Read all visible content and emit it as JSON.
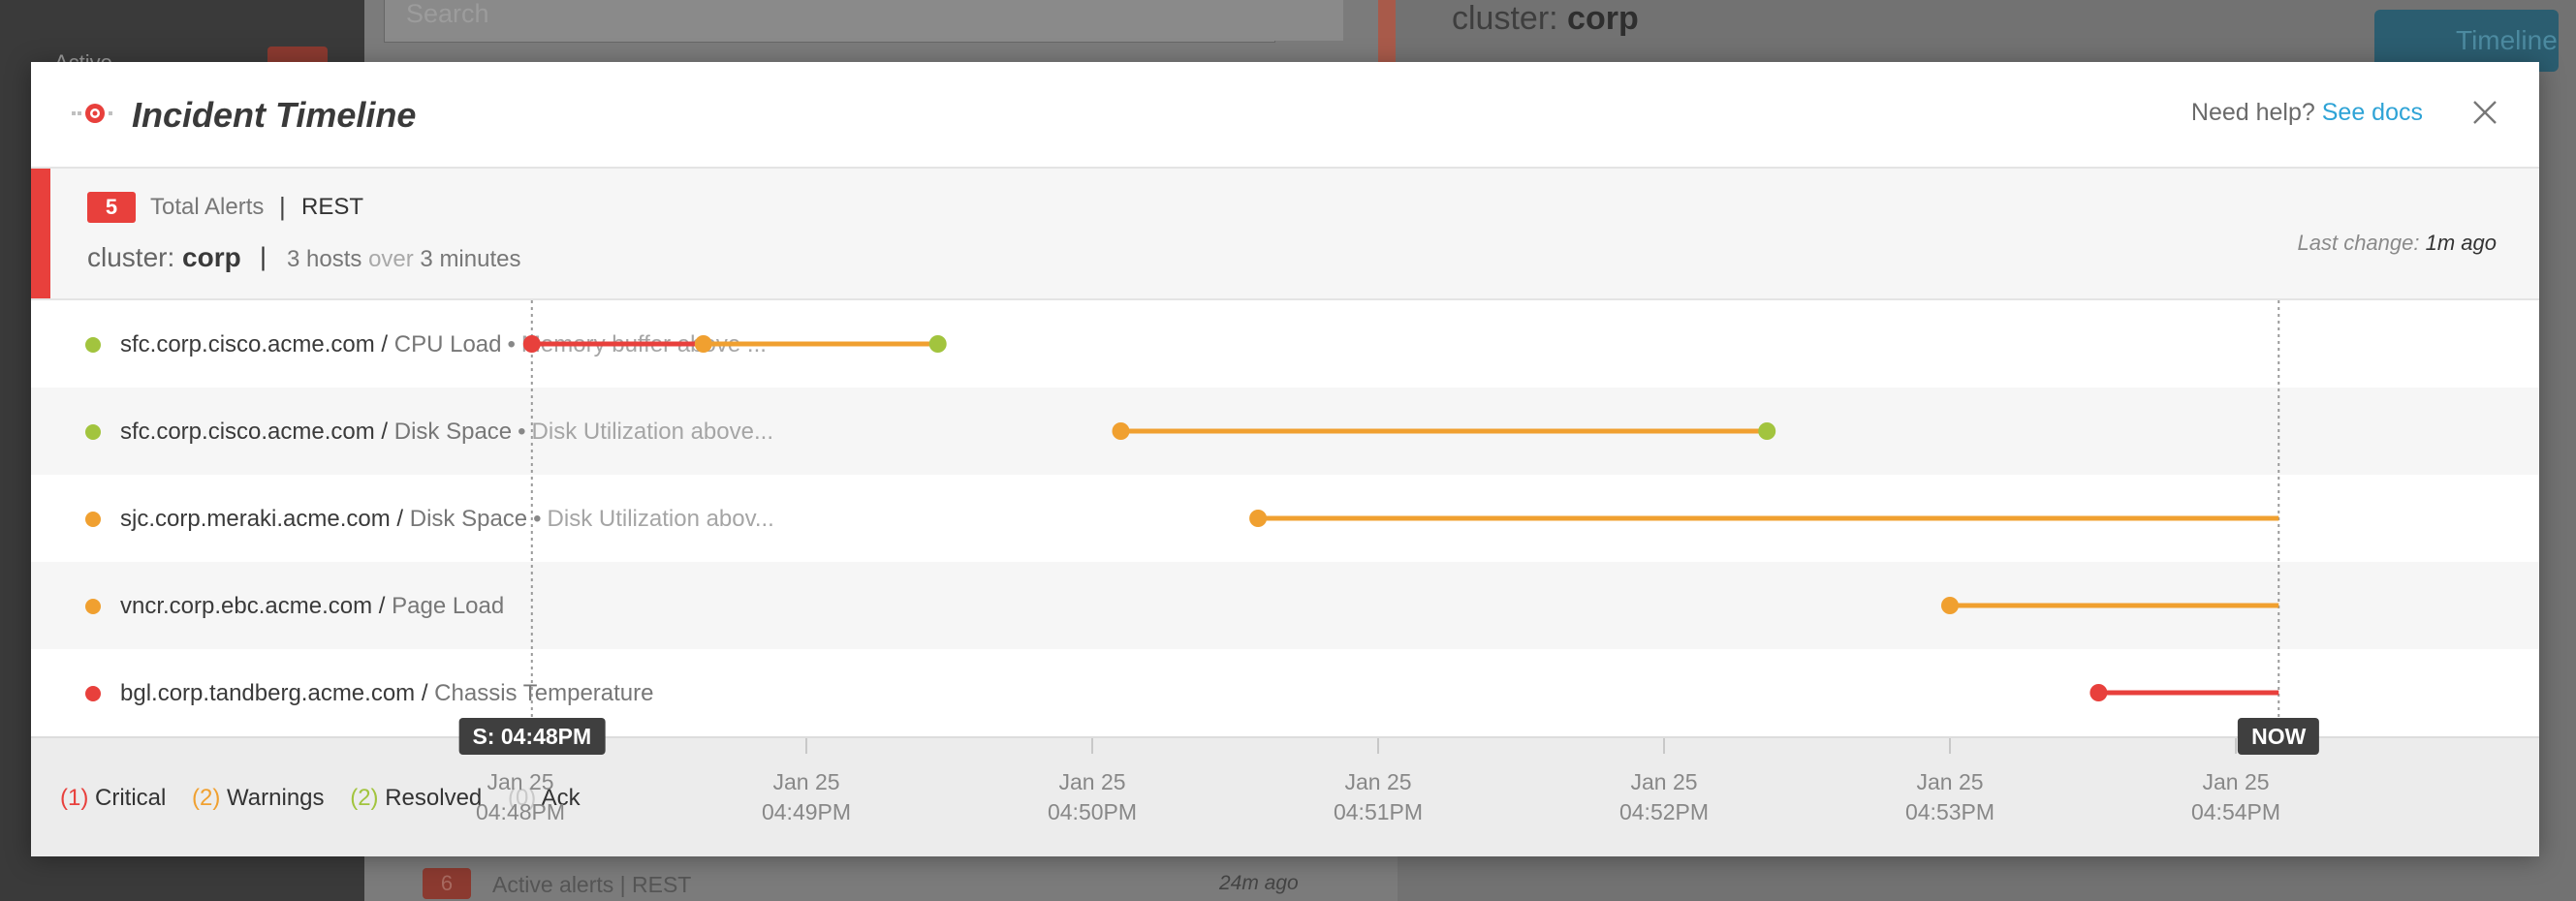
{
  "background": {
    "search_placeholder": "Search",
    "sidebar_active_label": "Active",
    "cluster_prefix": "cluster:",
    "cluster_name": "corp",
    "timeline_button": "Timeline",
    "bottom_badge": "6",
    "bottom_label": "Active alerts  |  REST",
    "bottom_time": "24m ago"
  },
  "modal": {
    "title": "Incident Timeline",
    "help_text": "Need help?",
    "help_link": "See docs",
    "icon": "close-icon"
  },
  "summary": {
    "total_count": "5",
    "total_label": "Total Alerts",
    "separator": "|",
    "source": "REST",
    "cluster_prefix": "cluster:",
    "cluster_name": "corp",
    "hosts_count": "3 hosts",
    "hosts_over": "over",
    "duration": "3 minutes",
    "last_change_label": "Last change:",
    "last_change_value": "1m ago",
    "accent_color": "#e8403c"
  },
  "colors": {
    "critical": "#e8403c",
    "warning": "#f0a030",
    "resolved": "#a2c43e",
    "ack": "#c9c9c9"
  },
  "alerts": [
    {
      "host": "sfc.corp.cisco.acme.com /",
      "check": "CPU Load",
      "bullet": "•",
      "desc": "Memory buffer above ...",
      "status": "resolved"
    },
    {
      "host": "sfc.corp.cisco.acme.com /",
      "check": "Disk Space",
      "bullet": "•",
      "desc": "Disk Utilization above...",
      "status": "resolved"
    },
    {
      "host": "sjc.corp.meraki.acme.com /",
      "check": "Disk Space",
      "bullet": "•",
      "desc": "Disk Utilization abov...",
      "status": "warning"
    },
    {
      "host": "vncr.corp.ebc.acme.com /",
      "check": "Page Load",
      "bullet": "",
      "desc": "",
      "status": "warning"
    },
    {
      "host": "bgl.corp.tandberg.acme.com /",
      "check": "Chassis Temperature",
      "bullet": "",
      "desc": "",
      "status": "critical"
    }
  ],
  "legend": [
    {
      "count": "(1)",
      "label": "Critical",
      "color": "#e8403c"
    },
    {
      "count": "(2)",
      "label": "Warnings",
      "color": "#f0a030"
    },
    {
      "count": "(2)",
      "label": "Resolved",
      "color": "#a2c43e"
    },
    {
      "count": "(0)",
      "label": "Ack",
      "color": "#c9c9c9"
    }
  ],
  "timeline": {
    "start_marker": "S: 04:48PM",
    "now_marker": "NOW",
    "ticks": [
      {
        "date": "Jan 25",
        "time": "04:48PM"
      },
      {
        "date": "Jan 25",
        "time": "04:49PM"
      },
      {
        "date": "Jan 25",
        "time": "04:50PM"
      },
      {
        "date": "Jan 25",
        "time": "04:51PM"
      },
      {
        "date": "Jan 25",
        "time": "04:52PM"
      },
      {
        "date": "Jan 25",
        "time": "04:53PM"
      },
      {
        "date": "Jan 25",
        "time": "04:54PM"
      }
    ]
  },
  "chart_data": {
    "type": "timeline",
    "x_unit": "minutes after 04:48PM",
    "x_range": [
      0,
      6.2
    ],
    "start": 0.04,
    "now": 6.15,
    "series": [
      {
        "segments": [
          {
            "from": 0.04,
            "to": 0.64,
            "status": "critical"
          },
          {
            "from": 0.64,
            "to": 1.46,
            "status": "warning"
          }
        ],
        "end": {
          "at": 1.46,
          "status": "resolved"
        }
      },
      {
        "segments": [
          {
            "from": 2.1,
            "to": 4.36,
            "status": "warning"
          }
        ],
        "end": {
          "at": 4.36,
          "status": "resolved"
        }
      },
      {
        "segments": [
          {
            "from": 2.58,
            "to": 6.15,
            "status": "warning"
          }
        ],
        "end": null
      },
      {
        "segments": [
          {
            "from": 5.0,
            "to": 6.15,
            "status": "warning"
          }
        ],
        "end": null
      },
      {
        "segments": [
          {
            "from": 5.52,
            "to": 6.15,
            "status": "critical"
          }
        ],
        "end": null
      }
    ]
  }
}
